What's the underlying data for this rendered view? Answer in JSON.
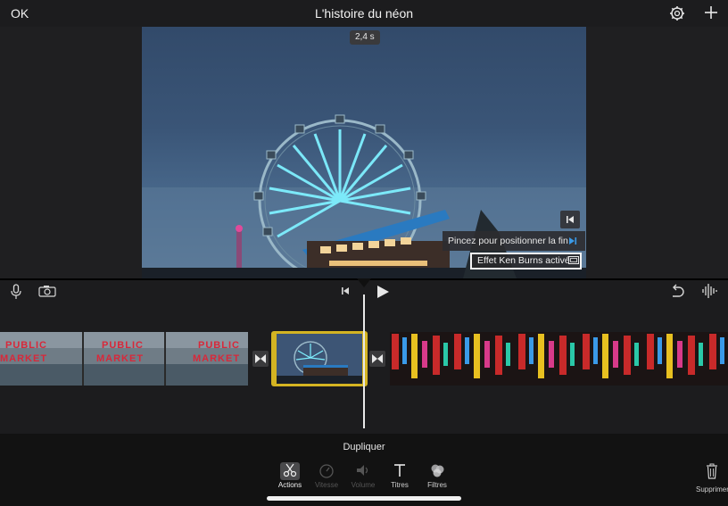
{
  "header": {
    "ok_label": "OK",
    "title": "L'histoire du néon",
    "settings_icon": "gear-icon",
    "add_icon": "plus-icon"
  },
  "viewer": {
    "duration": "2,4 s",
    "tip_text": "Pincez pour positionner la fin",
    "ken_burns_label": "Effet Ken Burns activé"
  },
  "controls": {
    "mic_icon": "microphone-icon",
    "camera_icon": "camera-icon",
    "skip_icon": "skip-to-start-icon",
    "play_icon": "play-icon",
    "undo_icon": "undo-icon",
    "audio_icon": "waveform-icon"
  },
  "timeline": {
    "clips": [
      {
        "name": "public-market-clip",
        "text": "PUBLIC MARKET"
      },
      {
        "name": "ferris-wheel-clip",
        "selected": true
      },
      {
        "name": "neon-signs-clip"
      }
    ]
  },
  "toolbar": {
    "context_label": "Dupliquer",
    "tools": [
      {
        "label": "Actions",
        "active": true
      },
      {
        "label": "Vitesse",
        "active": false
      },
      {
        "label": "Volume",
        "active": false
      },
      {
        "label": "Titres",
        "active": true
      },
      {
        "label": "Filtres",
        "active": true
      }
    ],
    "delete_label": "Supprimer"
  },
  "colors": {
    "accent_yellow": "#d4b422",
    "background": "#1c1c1e",
    "toolbar": "#121212"
  }
}
